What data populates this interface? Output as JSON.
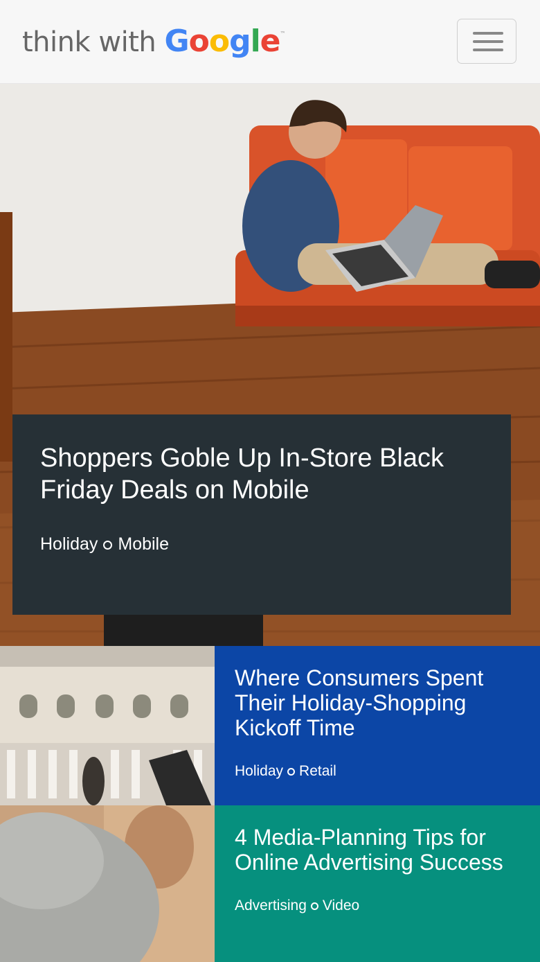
{
  "header": {
    "logo": {
      "prefix": "think with",
      "letters": [
        "G",
        "o",
        "o",
        "g",
        "l",
        "e"
      ],
      "letter_colors": [
        "#4285f4",
        "#ea4335",
        "#fbbc05",
        "#4285f4",
        "#34a853",
        "#ea4335"
      ],
      "trademark": "™"
    },
    "menu_icon": "hamburger-menu-icon"
  },
  "hero": {
    "title": "Shoppers Goble Up In-Store Black Friday Deals on Mobile",
    "tags": [
      "Holiday",
      "Mobile"
    ],
    "card_color": "#263036"
  },
  "stories": [
    {
      "title": "Where Consumers Spent Their Holiday-Shopping Kickoff Time",
      "tags": [
        "Holiday",
        "Retail"
      ],
      "color": "#0c46a6"
    },
    {
      "title": "4 Media-Planning Tips for Online Advertising Success",
      "tags": [
        "Advertising",
        "Video"
      ],
      "color": "#06907e"
    }
  ]
}
